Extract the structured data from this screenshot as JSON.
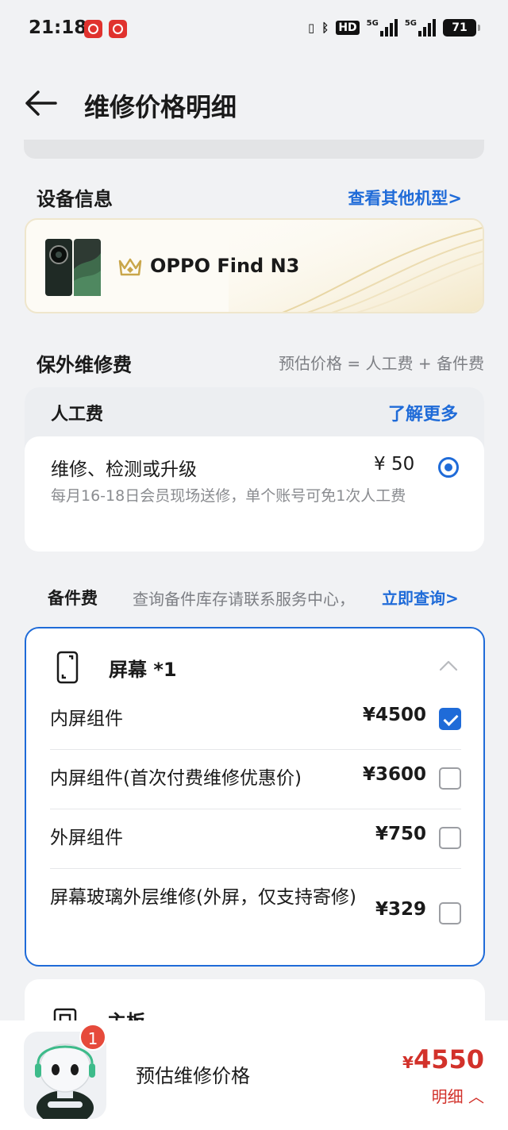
{
  "status": {
    "time": "21:18",
    "battery": "71",
    "hd": "HD",
    "net1": "5G",
    "net2": "5G"
  },
  "header": {
    "title": "维修价格明细"
  },
  "device": {
    "section_title": "设备信息",
    "other_models_link": "查看其他机型>",
    "name": "OPPO Find N3"
  },
  "warranty": {
    "section_title": "保外维修费",
    "formula": "预估价格 = 人工费 + 备件费"
  },
  "labor": {
    "title": "人工费",
    "learn_more": "了解更多",
    "item": "维修、检测或升级",
    "price": "¥ 50",
    "note": "每月16-18日会员现场送修，单个账号可免1次人工费",
    "selected": true
  },
  "parts": {
    "title": "备件费",
    "note": "查询备件库存请联系服务中心，",
    "link": "立即查询>"
  },
  "screen": {
    "label": "屏幕 *1",
    "items": [
      {
        "name": "内屏组件",
        "price": "¥4500",
        "checked": true
      },
      {
        "name": "内屏组件(首次付费维修优惠价)",
        "price": "¥3600",
        "checked": false
      },
      {
        "name": "外屏组件",
        "price": "¥750",
        "checked": false
      },
      {
        "name": "屏幕玻璃外层维修(外屏，仅支持寄修)",
        "price": "¥329",
        "checked": false
      }
    ]
  },
  "board": {
    "label": "主板"
  },
  "footer": {
    "badge": "1",
    "estimate_label": "预估维修价格",
    "currency": "¥",
    "total": "4550",
    "detail": "明细"
  },
  "colors": {
    "accent": "#1f6bd8",
    "price": "#d2312a"
  }
}
